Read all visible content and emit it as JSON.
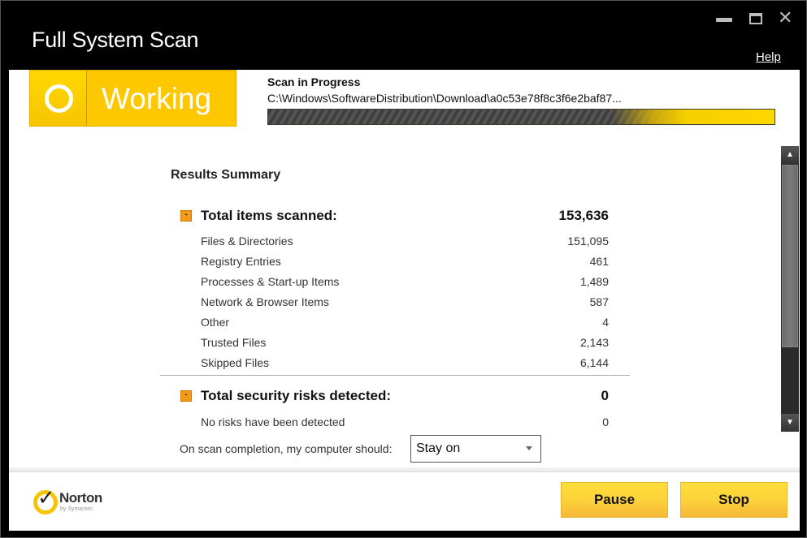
{
  "window": {
    "title": "Full System Scan",
    "help_label": "Help",
    "controls": {
      "minimize": "minimize",
      "maximize": "maximize",
      "close": "✕"
    }
  },
  "status": {
    "label": "Working",
    "icon": "ring-icon",
    "color": "#fdc800"
  },
  "scan": {
    "title": "Scan in Progress",
    "current_path": "C:\\Windows\\SoftwareDistribution\\Download\\a0c53e78f8c3f6e2baf87...",
    "progress_state": "indeterminate"
  },
  "results": {
    "title": "Results Summary",
    "total_scanned": {
      "label": "Total items scanned:",
      "value": "153,636",
      "rows": [
        {
          "label": "Files & Directories",
          "value": "151,095"
        },
        {
          "label": "Registry Entries",
          "value": "461"
        },
        {
          "label": "Processes & Start-up Items",
          "value": "1,489"
        },
        {
          "label": "Network & Browser Items",
          "value": "587"
        },
        {
          "label": "Other",
          "value": "4"
        },
        {
          "label": "Trusted Files",
          "value": "2,143"
        },
        {
          "label": "Skipped Files",
          "value": "6,144"
        }
      ]
    },
    "total_risks": {
      "label": "Total security risks detected:",
      "value": "0",
      "rows": [
        {
          "label": "No risks have been detected",
          "value": "0"
        }
      ]
    },
    "collapse_symbol": "-"
  },
  "completion": {
    "label": "On scan completion, my computer should:",
    "selected": "Stay on"
  },
  "footer": {
    "brand": "Norton",
    "brand_sub": "by Symantec",
    "pause_label": "Pause",
    "stop_label": "Stop"
  },
  "scrollbar": {
    "up_glyph": "▲",
    "down_glyph": "▼"
  }
}
